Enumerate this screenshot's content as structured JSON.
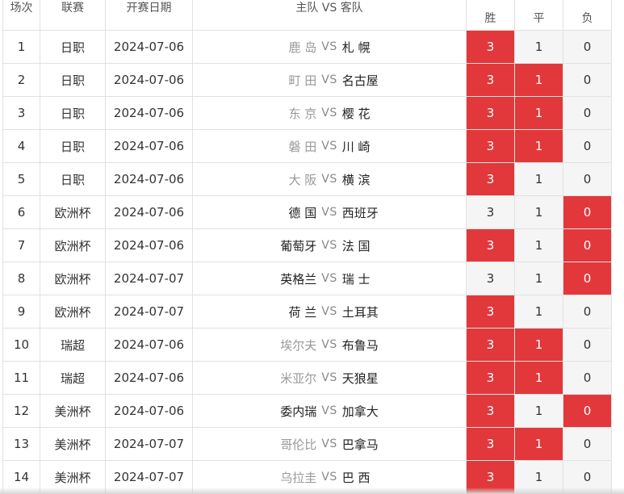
{
  "header": {
    "idx": "场次",
    "league": "联赛",
    "date": "开赛日期",
    "match": "主队 VS 客队",
    "win": "胜",
    "draw": "平",
    "lose": "负"
  },
  "vs_label": "VS",
  "colors": {
    "selected": "#e2383b",
    "unselected": "#f5f5f5",
    "border": "#e1e1e1"
  },
  "rows": [
    {
      "idx": "1",
      "league": "日职",
      "date": "2024-07-06",
      "home": "鹿 岛",
      "away": "札 幌",
      "home_style": "muted",
      "win": "3",
      "draw": "1",
      "lose": "0",
      "sel": [
        true,
        false,
        false
      ]
    },
    {
      "idx": "2",
      "league": "日职",
      "date": "2024-07-06",
      "home": "町 田",
      "away": "名古屋",
      "home_style": "muted",
      "win": "3",
      "draw": "1",
      "lose": "0",
      "sel": [
        true,
        true,
        false
      ]
    },
    {
      "idx": "3",
      "league": "日职",
      "date": "2024-07-06",
      "home": "东 京",
      "away": "樱 花",
      "home_style": "muted",
      "win": "3",
      "draw": "1",
      "lose": "0",
      "sel": [
        true,
        true,
        false
      ]
    },
    {
      "idx": "4",
      "league": "日职",
      "date": "2024-07-06",
      "home": "磐 田",
      "away": "川 崎",
      "home_style": "muted",
      "win": "3",
      "draw": "1",
      "lose": "0",
      "sel": [
        true,
        true,
        false
      ]
    },
    {
      "idx": "5",
      "league": "日职",
      "date": "2024-07-06",
      "home": "大 阪",
      "away": "横 滨",
      "home_style": "muted",
      "win": "3",
      "draw": "1",
      "lose": "0",
      "sel": [
        true,
        false,
        false
      ]
    },
    {
      "idx": "6",
      "league": "欧洲杯",
      "date": "2024-07-06",
      "home": "德 国",
      "away": "西班牙",
      "home_style": "strong",
      "win": "3",
      "draw": "1",
      "lose": "0",
      "sel": [
        false,
        false,
        true
      ]
    },
    {
      "idx": "7",
      "league": "欧洲杯",
      "date": "2024-07-06",
      "home": "葡萄牙",
      "away": "法 国",
      "home_style": "strong",
      "win": "3",
      "draw": "1",
      "lose": "0",
      "sel": [
        true,
        false,
        true
      ]
    },
    {
      "idx": "8",
      "league": "欧洲杯",
      "date": "2024-07-07",
      "home": "英格兰",
      "away": "瑞 士",
      "home_style": "strong",
      "win": "3",
      "draw": "1",
      "lose": "0",
      "sel": [
        false,
        false,
        true
      ]
    },
    {
      "idx": "9",
      "league": "欧洲杯",
      "date": "2024-07-07",
      "home": "荷 兰",
      "away": "土耳其",
      "home_style": "strong",
      "win": "3",
      "draw": "1",
      "lose": "0",
      "sel": [
        true,
        false,
        false
      ]
    },
    {
      "idx": "10",
      "league": "瑞超",
      "date": "2024-07-06",
      "home": "埃尔夫",
      "away": "布鲁马",
      "home_style": "muted",
      "win": "3",
      "draw": "1",
      "lose": "0",
      "sel": [
        true,
        true,
        false
      ]
    },
    {
      "idx": "11",
      "league": "瑞超",
      "date": "2024-07-06",
      "home": "米亚尔",
      "away": "天狼星",
      "home_style": "muted",
      "win": "3",
      "draw": "1",
      "lose": "0",
      "sel": [
        true,
        true,
        false
      ]
    },
    {
      "idx": "12",
      "league": "美洲杯",
      "date": "2024-07-06",
      "home": "委内瑞",
      "away": "加拿大",
      "home_style": "strong",
      "win": "3",
      "draw": "1",
      "lose": "0",
      "sel": [
        true,
        false,
        true
      ]
    },
    {
      "idx": "13",
      "league": "美洲杯",
      "date": "2024-07-07",
      "home": "哥伦比",
      "away": "巴拿马",
      "home_style": "muted",
      "win": "3",
      "draw": "1",
      "lose": "0",
      "sel": [
        true,
        true,
        false
      ]
    },
    {
      "idx": "14",
      "league": "美洲杯",
      "date": "2024-07-07",
      "home": "乌拉圭",
      "away": "巴 西",
      "home_style": "muted",
      "win": "3",
      "draw": "1",
      "lose": "0",
      "sel": [
        true,
        false,
        false
      ]
    }
  ]
}
